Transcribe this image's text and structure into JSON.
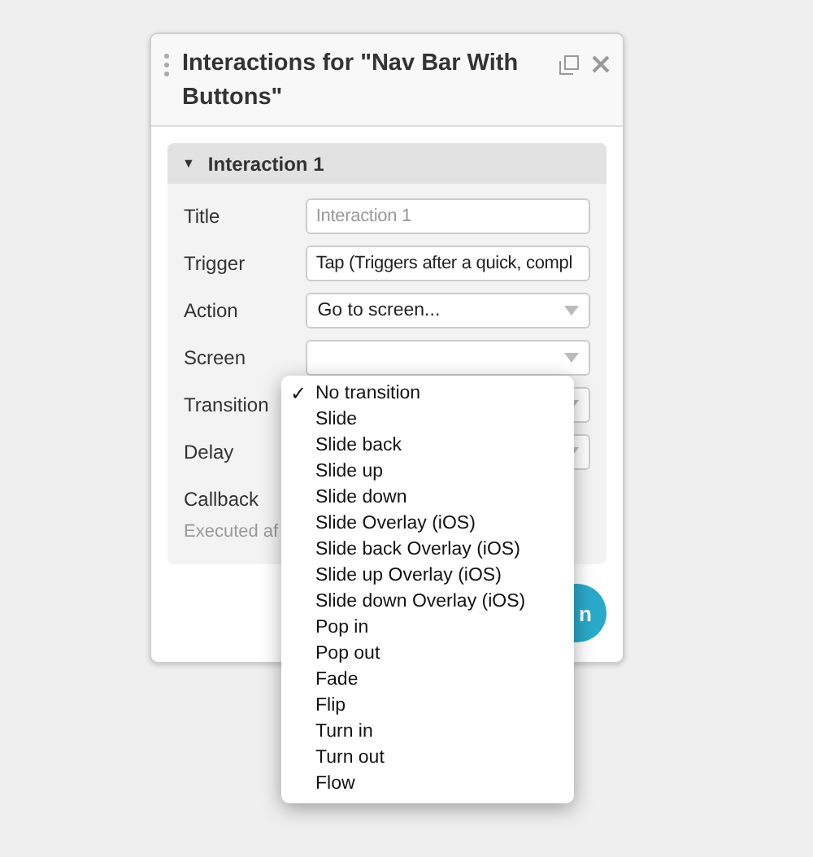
{
  "panel": {
    "title": "Interactions for \"Nav Bar With Buttons\""
  },
  "interaction": {
    "title": "Interaction 1",
    "expanded": true,
    "toggle_icon": "▼",
    "fields": [
      {
        "label": "Title",
        "kind": "text",
        "placeholder": "Interaction 1"
      },
      {
        "label": "Trigger",
        "kind": "text",
        "value": "Tap (Triggers after a quick, compl"
      },
      {
        "label": "Action",
        "kind": "select",
        "value": "Go to screen..."
      },
      {
        "label": "Screen",
        "kind": "select"
      },
      {
        "label": "Transition",
        "kind": "select"
      },
      {
        "label": "Delay",
        "kind": "select"
      },
      {
        "label": "Callback",
        "kind": "none"
      }
    ],
    "note": "Executed af"
  },
  "button": {
    "label": "n"
  },
  "menu_check": "✓",
  "menu": [
    {
      "label": "No transition",
      "selected": true
    },
    {
      "label": "Slide",
      "selected": false
    },
    {
      "label": "Slide back",
      "selected": false
    },
    {
      "label": "Slide up",
      "selected": false
    },
    {
      "label": "Slide down",
      "selected": false
    },
    {
      "label": "Slide Overlay (iOS)",
      "selected": false
    },
    {
      "label": "Slide back Overlay (iOS)",
      "selected": false
    },
    {
      "label": "Slide up Overlay (iOS)",
      "selected": false
    },
    {
      "label": "Slide down Overlay (iOS)",
      "selected": false
    },
    {
      "label": "Pop in",
      "selected": false
    },
    {
      "label": "Pop out",
      "selected": false
    },
    {
      "label": "Fade",
      "selected": false
    },
    {
      "label": "Flip",
      "selected": false
    },
    {
      "label": "Turn in",
      "selected": false
    },
    {
      "label": "Turn out",
      "selected": false
    },
    {
      "label": "Flow",
      "selected": false
    }
  ]
}
